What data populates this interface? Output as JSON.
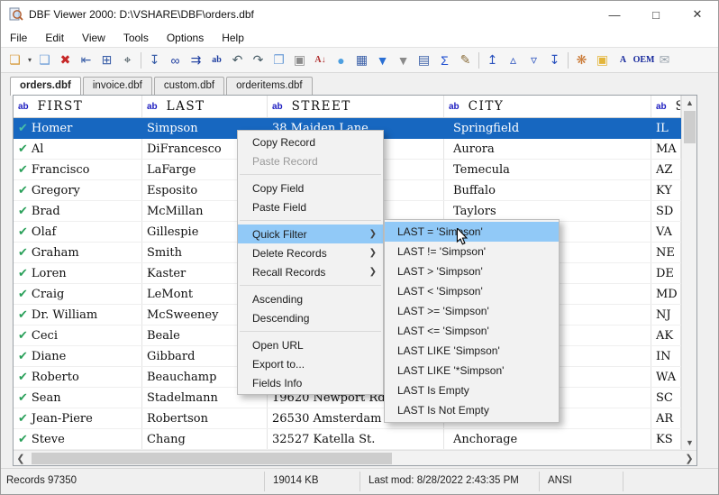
{
  "window": {
    "title": "DBF Viewer 2000: D:\\VSHARE\\DBF\\orders.dbf"
  },
  "window_controls": {
    "minimize": "—",
    "maximize": "□",
    "close": "✕"
  },
  "menubar": [
    "File",
    "Edit",
    "View",
    "Tools",
    "Options",
    "Help"
  ],
  "toolbar": [
    {
      "name": "open-file",
      "glyph": "❏",
      "color": "#d79b3c"
    },
    {
      "name": "open-file-dropdown",
      "glyph": "▾",
      "color": "#444444",
      "caret": true
    },
    {
      "name": "new-file",
      "glyph": "❑",
      "color": "#6f9fd8"
    },
    {
      "name": "delete-record",
      "glyph": "✖",
      "color": "#c62828"
    },
    {
      "name": "goto-record",
      "glyph": "⇤",
      "color": "#3a5fa8"
    },
    {
      "name": "structure",
      "glyph": "⊞",
      "color": "#3a5fa8"
    },
    {
      "name": "zoom",
      "glyph": "⌖",
      "color": "#37474f",
      "sep": true
    },
    {
      "name": "save-append",
      "glyph": "↧",
      "color": "#3a5fa8"
    },
    {
      "name": "find",
      "glyph": "∞",
      "color": "#1a3a9e"
    },
    {
      "name": "find-next",
      "glyph": "⇉",
      "color": "#1a3a9e"
    },
    {
      "name": "replace",
      "glyph": "ab",
      "color": "#1a3a9e",
      "text": true
    },
    {
      "name": "undo",
      "glyph": "↶",
      "color": "#455a64"
    },
    {
      "name": "redo",
      "glyph": "↷",
      "color": "#455a64"
    },
    {
      "name": "copy",
      "glyph": "❐",
      "color": "#6f9fd8"
    },
    {
      "name": "paste",
      "glyph": "▣",
      "color": "#8d8d8d"
    },
    {
      "name": "sort-az",
      "glyph": "A↓",
      "color": "#b03030",
      "text": true
    },
    {
      "name": "comment",
      "glyph": "●",
      "color": "#4d9fe0"
    },
    {
      "name": "filter-grid",
      "glyph": "▦",
      "color": "#3a5fa8"
    },
    {
      "name": "set-filter",
      "glyph": "▼",
      "color": "#2a6fd4"
    },
    {
      "name": "clear-filter",
      "glyph": "▼",
      "color": "#8a8a8a"
    },
    {
      "name": "table-view",
      "glyph": "▤",
      "color": "#3a5fa8"
    },
    {
      "name": "sum",
      "glyph": "Σ",
      "color": "#1f4fd0"
    },
    {
      "name": "pack",
      "glyph": "✎",
      "color": "#8a6d3b",
      "sep": true
    },
    {
      "name": "first-record",
      "glyph": "↥",
      "color": "#2a52be"
    },
    {
      "name": "prev-record",
      "glyph": "▵",
      "color": "#2a52be"
    },
    {
      "name": "next-record",
      "glyph": "▿",
      "color": "#2a52be"
    },
    {
      "name": "last-record",
      "glyph": "↧",
      "color": "#2a52be",
      "sep": true
    },
    {
      "name": "color-palette",
      "glyph": "❋",
      "color": "#c9752e"
    },
    {
      "name": "highlight",
      "glyph": "▣",
      "color": "#e3b53a"
    },
    {
      "name": "font",
      "glyph": "A",
      "color": "#16289c",
      "text": true
    },
    {
      "name": "oem",
      "glyph": "OEM",
      "color": "#16289c",
      "text": true
    },
    {
      "name": "export-mail",
      "glyph": "✉",
      "color": "#9aa4ad"
    }
  ],
  "tabs": [
    {
      "label": "orders.dbf",
      "active": true
    },
    {
      "label": "invoice.dbf",
      "active": false
    },
    {
      "label": "custom.dbf",
      "active": false
    },
    {
      "label": "orderitems.dbf",
      "active": false
    }
  ],
  "table": {
    "columns": [
      {
        "type_badge": "ab",
        "label": "FIRST"
      },
      {
        "type_badge": "ab",
        "label": "LAST"
      },
      {
        "type_badge": "ab",
        "label": "STREET"
      },
      {
        "type_badge": "ab",
        "label": "CITY"
      },
      {
        "type_badge": "ab",
        "label": "S"
      }
    ],
    "rows": [
      {
        "first": "Homer",
        "last": "Simpson",
        "street": "38 Maiden Lane",
        "city": "Springfield",
        "state": "IL",
        "selected": true,
        "checked": true
      },
      {
        "first": "Al",
        "last": "DiFrancesco",
        "street": "nue",
        "street_clipped": true,
        "city": "Aurora",
        "state": "MA",
        "checked": true
      },
      {
        "first": "Francisco",
        "last": "LaFarge",
        "street": "ne",
        "street_clipped": true,
        "city": "Temecula",
        "state": "AZ",
        "checked": true
      },
      {
        "first": "Gregory",
        "last": "Esposito",
        "street": "",
        "city": "Buffalo",
        "state": "KY",
        "checked": true
      },
      {
        "first": "Brad",
        "last": "McMillan",
        "street": "t.",
        "street_clipped": true,
        "city": "Taylors",
        "state": "SD",
        "checked": true
      },
      {
        "first": "Olaf",
        "last": "Gillespie",
        "street": "",
        "city": "",
        "state": "VA",
        "checked": true
      },
      {
        "first": "Graham",
        "last": "Smith",
        "street": "",
        "city": "",
        "state": "NE",
        "checked": true
      },
      {
        "first": "Loren",
        "last": "Kaster",
        "street": "",
        "city": "",
        "state": "DE",
        "checked": true
      },
      {
        "first": "Craig",
        "last": "LeMont",
        "street": "",
        "city": "",
        "state": "MD",
        "checked": true
      },
      {
        "first": "Dr. William",
        "last": "McSweeney",
        "street": "",
        "city": "",
        "state": "NJ",
        "checked": true
      },
      {
        "first": "Ceci",
        "last": "Beale",
        "street": "",
        "city": "",
        "state": "AK",
        "checked": true
      },
      {
        "first": "Diane",
        "last": "Gibbard",
        "street": "",
        "city": "",
        "state": "IN",
        "checked": true
      },
      {
        "first": "Roberto",
        "last": "Beauchamp",
        "street": "",
        "city": "",
        "state": "WA",
        "checked": true
      },
      {
        "first": "Sean",
        "last": "Stadelmann",
        "street": "19620 Newport Rd",
        "city": "",
        "state": "SC",
        "checked": true
      },
      {
        "first": "Jean-Piere",
        "last": "Robertson",
        "street": "26530 Amsterdam A",
        "city": "",
        "state": "AR",
        "checked": true
      },
      {
        "first": "Steve",
        "last": "Chang",
        "street": "32527 Katella St.",
        "city": "Anchorage",
        "state": "KS",
        "checked": true
      }
    ]
  },
  "context_menu": {
    "items": [
      {
        "label": "Copy Record"
      },
      {
        "label": "Paste Record",
        "disabled": true
      },
      {
        "type": "sep"
      },
      {
        "label": "Copy Field"
      },
      {
        "label": "Paste Field"
      },
      {
        "type": "sep"
      },
      {
        "label": "Quick Filter",
        "submenu": true,
        "highlighted": true
      },
      {
        "label": "Delete Records",
        "submenu": true
      },
      {
        "label": "Recall Records",
        "submenu": true
      },
      {
        "type": "sep"
      },
      {
        "label": "Ascending"
      },
      {
        "label": "Descending"
      },
      {
        "type": "sep"
      },
      {
        "label": "Open URL"
      },
      {
        "label": "Export to..."
      },
      {
        "label": "Fields Info"
      }
    ]
  },
  "quick_filter_submenu": {
    "items": [
      {
        "label": "LAST = 'Simpson'",
        "highlighted": true
      },
      {
        "label": "LAST != 'Simpson'"
      },
      {
        "label": "LAST > 'Simpson'"
      },
      {
        "label": "LAST < 'Simpson'"
      },
      {
        "label": "LAST >= 'Simpson'"
      },
      {
        "label": "LAST <= 'Simpson'"
      },
      {
        "label": "LAST LIKE 'Simpson'"
      },
      {
        "label": "LAST LIKE '*Simpson'"
      },
      {
        "label": "LAST Is Empty"
      },
      {
        "label": "LAST Is Not Empty"
      }
    ]
  },
  "status_bar": {
    "records": "Records 97350",
    "file_size": "19014 KB",
    "last_mod": "Last mod: 8/28/2022 2:43:35 PM",
    "encoding": "ANSI"
  },
  "colors": {
    "selection_blue": "#1767c0",
    "menu_highlight_blue": "#91c9f7",
    "check_green": "#2aa05a",
    "field_type_badge_blue": "#1c1cc0"
  }
}
